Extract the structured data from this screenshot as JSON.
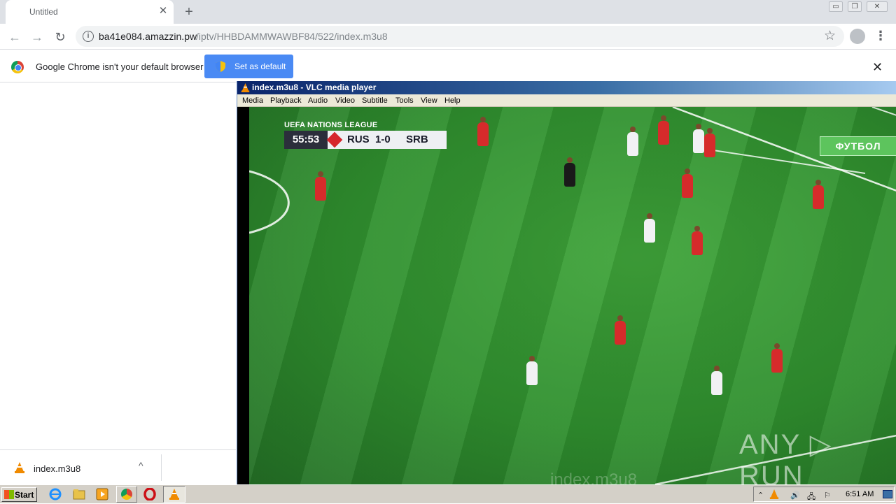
{
  "browser": {
    "tab": {
      "title": "Untitled",
      "close": "✕"
    },
    "new_tab": "+",
    "window_buttons": [
      "▭",
      "❐",
      "✕"
    ],
    "toolbar": {
      "back": "←",
      "forward": "→",
      "reload": "↻",
      "url_domain": "ba41e084.amazzin.pw",
      "url_path": "/iptv/HHBDAMMWAWBF84/522/index.m3u8",
      "info_icon": "i",
      "star_icon": "☆",
      "menu_icon": "⋮"
    },
    "infobar": {
      "message": "Google Chrome isn't your default browser",
      "button_label": "Set as default",
      "close": "✕"
    },
    "downloads": {
      "file_name": "index.m3u8",
      "chevron": "^"
    }
  },
  "vlc": {
    "title": "index.m3u8 - VLC media player",
    "menu": [
      "Media",
      "Playback",
      "Audio",
      "Video",
      "Subtitle",
      "Tools",
      "View",
      "Help"
    ],
    "video": {
      "league": "UEFA NATIONS LEAGUE",
      "clock": "55:53",
      "home": "RUS",
      "score": "1-0",
      "away": "SRB",
      "channel": "ФУТБОЛ",
      "watermark": "ANY ▷ RUN",
      "overlay_name": "index.m3u8"
    }
  },
  "taskbar": {
    "start_label": "Start",
    "clock": "6:51 AM",
    "icons": [
      "internet-explorer-icon",
      "folder-icon",
      "media-player-icon",
      "chrome-icon",
      "opera-icon",
      "vlc-icon"
    ]
  },
  "colors": {
    "chrome_blue": "#4a8af4",
    "vlc_title": "#0a246a",
    "pitch_green": "#2f8f2e",
    "russia_red": "#d62b2b"
  }
}
